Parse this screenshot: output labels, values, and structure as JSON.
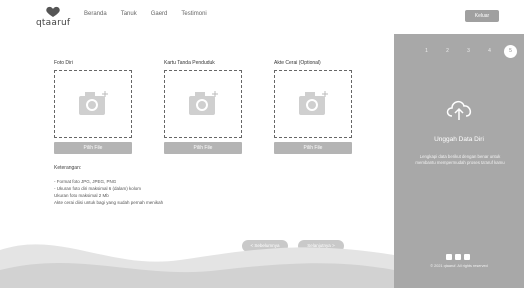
{
  "header": {
    "logo_text": "qtaaruf",
    "nav": [
      "Beranda",
      "Tanuk",
      "Gaerd",
      "Testimoni"
    ],
    "logout_label": "Keluar"
  },
  "uploads": [
    {
      "label": "Foto Diri",
      "button": "Pilih File"
    },
    {
      "label": "Kartu Tanda Penduduk",
      "button": "Pilih File"
    },
    {
      "label": "Akte Cerai (Optional)",
      "button": "Pilih File"
    }
  ],
  "notes": {
    "title": "Keterangan:",
    "lines": [
      "- Format foto JPG, JPEG, PNG",
      "- Ukuran foto diri maksimal 6 (dalam) kolom",
      "  Ukuran foto maksimal 2 Mb",
      "  Akte cerai diisi untuk bagi yang sudah pernah menikah"
    ]
  },
  "actions": {
    "prev_label": "< Sebelumnya",
    "next_label": "Selanjutnya >"
  },
  "sidebar": {
    "steps": [
      "1",
      "2",
      "3",
      "4",
      "5"
    ],
    "active_step": "5",
    "title": "Unggah Data Diri",
    "description": "Lengkapi data berikut dengan benar untuk membantu mempermudah proses ta'aruf kamu",
    "copyright": "© 2021 qtaaruf. All rights reserved"
  },
  "colors": {
    "sidebar_bg": "#a8a8a8",
    "button_gray": "#b4b4b4",
    "wave_gray": "#d6d6d6"
  }
}
